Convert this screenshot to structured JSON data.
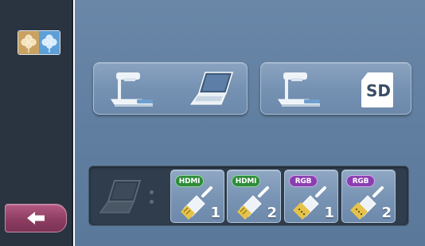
{
  "sidebar": {
    "logo_icon": "clover-icon",
    "back_icon": "left-arrow-icon",
    "colors": {
      "panel": "#2a3440",
      "back_button": "#8e3d62"
    }
  },
  "main": {
    "background": "#6a87a8",
    "mode_buttons": [
      {
        "id": "camera-to-pc",
        "icons": [
          "document-camera-icon",
          "laptop-icon"
        ]
      },
      {
        "id": "camera-to-sd",
        "icons": [
          "document-camera-icon",
          "sd-card-icon"
        ],
        "sd_label": "SD"
      }
    ],
    "sources": {
      "pc_icon": "laptop-icon",
      "items": [
        {
          "badge": "HDMI",
          "number": "1",
          "badge_color": "#2e8b3a"
        },
        {
          "badge": "HDMI",
          "number": "2",
          "badge_color": "#2e8b3a"
        },
        {
          "badge": "RGB",
          "number": "1",
          "badge_color": "#8a3fb0"
        },
        {
          "badge": "RGB",
          "number": "2",
          "badge_color": "#8a3fb0"
        }
      ]
    }
  }
}
